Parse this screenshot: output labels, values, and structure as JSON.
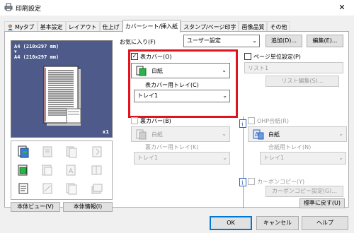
{
  "window": {
    "title": "印刷設定",
    "close_glyph": "✕",
    "icon": "printer-icon"
  },
  "tabs": [
    {
      "label": "Myタブ",
      "icon": "user-icon"
    },
    {
      "label": "基本設定"
    },
    {
      "label": "レイアウト"
    },
    {
      "label": "仕上げ"
    },
    {
      "label": "カバーシート/挿入紙",
      "active": true
    },
    {
      "label": "スタンプ/ページ印字"
    },
    {
      "label": "画像品質"
    },
    {
      "label": "その他"
    }
  ],
  "preview": {
    "line1": "A4 (210x297 mm)",
    "arrow": "▼",
    "line2": "A4 (210x297 mm)",
    "count": "x1"
  },
  "left_buttons": {
    "view": "本体ビュー(V)",
    "info": "本体情報(I)"
  },
  "favorites": {
    "label": "お気に入り(F)",
    "value": "ユーザー設定",
    "add_button": "追加(D)...",
    "edit_button": "編集(E)..."
  },
  "front_cover": {
    "checkbox_label": "表カバー(O)",
    "checked": true,
    "check_glyph": "✓",
    "paper_value": "白紙",
    "tray_label": "表カバー用トレイ(C)",
    "tray_value": "トレイ1"
  },
  "back_cover": {
    "checkbox_label": "裏カバー(B)",
    "checked": false,
    "paper_value": "白紙",
    "tray_label": "裏カバー用トレイ(K)",
    "tray_value": "トレイ1"
  },
  "page_setting": {
    "checkbox_label": "ページ単位設定(P)",
    "list_item": "リスト1",
    "edit_button": "リスト編集(S)..."
  },
  "ohp": {
    "checkbox_label": "OHP合紙(R)",
    "paper_value": "白紙",
    "tray_label": "合紙用トレイ(N)",
    "tray_value": "トレイ1"
  },
  "carbon_copy": {
    "checkbox_label": "カーボンコピー(Y)",
    "settings_button": "カーボンコピー設定(G)..."
  },
  "restore_button": "標準に戻す(U)",
  "footer": {
    "ok": "OK",
    "cancel": "キャンセル",
    "help": "ヘルプ"
  },
  "colors": {
    "highlight_border": "#e0141f",
    "preview_background": "#4e5b8a"
  }
}
